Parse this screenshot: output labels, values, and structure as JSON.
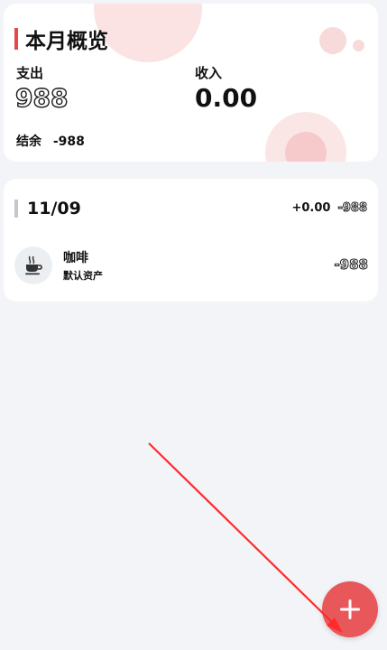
{
  "summary": {
    "title": "本月概览",
    "expense_label": "支出",
    "expense_value": "988",
    "income_label": "收入",
    "income_value": "0.00",
    "balance_label": "结余",
    "balance_value": "-988"
  },
  "day_groups": [
    {
      "date": "11/09",
      "income_total": "+0.00",
      "expense_total": "-988",
      "entries": [
        {
          "icon": "coffee-cup-icon",
          "name": "咖啡",
          "account": "默认资产",
          "amount": "-988"
        }
      ]
    }
  ],
  "fab": {
    "icon": "plus-icon"
  },
  "colors": {
    "accent": "#e54848",
    "fab": "#e8575a",
    "annotation_arrow": "#ff2a2a",
    "background": "#f3f4f7"
  }
}
